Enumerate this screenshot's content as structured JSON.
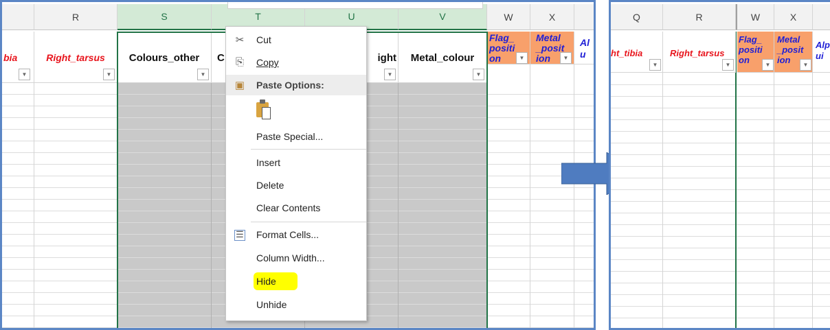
{
  "left_sheet": {
    "col_letters": [
      "R",
      "S",
      "T",
      "U",
      "V",
      "W",
      "X"
    ],
    "headers": {
      "q_partial": "bia",
      "r": "Right_tarsus",
      "s": "Colours_other",
      "t": "C",
      "u": "ight",
      "v": "Metal_colour",
      "w": "Flag_ positi on",
      "x": "Metal _posit ion",
      "y_partial": "Al u"
    }
  },
  "context_menu": {
    "cut": "Cut",
    "copy": "Copy",
    "paste_options": "Paste Options:",
    "paste_special": "Paste Special...",
    "insert": "Insert",
    "delete": "Delete",
    "clear_contents": "Clear Contents",
    "format_cells": "Format Cells...",
    "column_width": "Column Width...",
    "hide": "Hide",
    "unhide": "Unhide"
  },
  "right_sheet": {
    "col_letters": [
      "Q",
      "R",
      "W",
      "X"
    ],
    "headers": {
      "q": "ht_tibia",
      "r": "Right_tarsus",
      "w": "Flag_ positi on",
      "x": "Metal _posit ion",
      "y_partial": "Alp ui"
    }
  },
  "colors": {
    "selection_green": "#217346",
    "selected_fill": "#c9c9c9",
    "highlight_yellow": "#ffff00",
    "arrow_blue": "#4f7cc0",
    "orange_header": "#f8a06b"
  }
}
